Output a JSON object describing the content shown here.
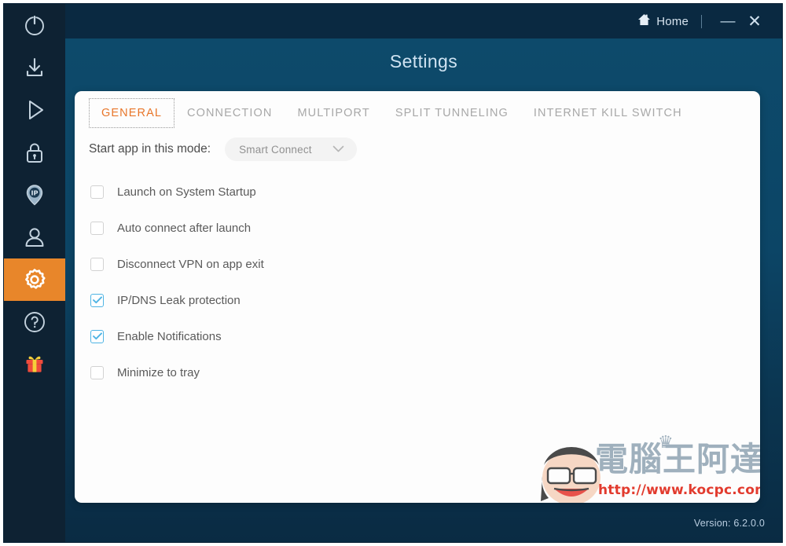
{
  "window": {
    "title": "Settings",
    "version_text": "Version: 6.2.0.0"
  },
  "titlebar": {
    "home_label": "Home",
    "home_icon": "house-icon",
    "minimize_label": "—",
    "close_label": "✕"
  },
  "sidebar": {
    "items": [
      {
        "name": "power",
        "icon": "power-icon",
        "active": false
      },
      {
        "name": "download",
        "icon": "download-icon",
        "active": false
      },
      {
        "name": "play",
        "icon": "play-icon",
        "active": false
      },
      {
        "name": "lock",
        "icon": "lock-icon",
        "active": false
      },
      {
        "name": "ip-location",
        "icon": "ip-pin-icon",
        "active": false
      },
      {
        "name": "account",
        "icon": "user-icon",
        "active": false
      },
      {
        "name": "settings",
        "icon": "gear-icon",
        "active": true
      },
      {
        "name": "help",
        "icon": "question-circle-icon",
        "active": false
      },
      {
        "name": "gift",
        "icon": "gift-icon",
        "active": false
      }
    ]
  },
  "tabs": [
    {
      "label": "GENERAL",
      "active": true
    },
    {
      "label": "CONNECTION",
      "active": false
    },
    {
      "label": "MULTIPORT",
      "active": false
    },
    {
      "label": "SPLIT TUNNELING",
      "active": false
    },
    {
      "label": "INTERNET KILL SWITCH",
      "active": false
    }
  ],
  "general": {
    "mode_label": "Start app in this mode:",
    "mode_value": "Smart Connect",
    "mode_chevron": "chevron-down-icon",
    "options": [
      {
        "label": "Launch on System Startup",
        "checked": false
      },
      {
        "label": "Auto connect after launch",
        "checked": false
      },
      {
        "label": "Disconnect VPN on app exit",
        "checked": false
      },
      {
        "label": "IP/DNS Leak protection",
        "checked": true
      },
      {
        "label": "Enable Notifications",
        "checked": true
      },
      {
        "label": "Minimize to tray",
        "checked": false
      }
    ]
  },
  "watermark": {
    "text": "電腦王阿達",
    "url": "http://www.kocpc.com.tw",
    "crown": "♛"
  },
  "colors": {
    "accent_orange": "#e8862a",
    "tab_active": "#e8762a",
    "checkbox_checked": "#4fb4e4",
    "sidebar_bg": "#0e2233",
    "titlebar_bg": "#0a2941",
    "panel_bg": "#fdfdfd",
    "watermark_red": "#e23b2e"
  }
}
